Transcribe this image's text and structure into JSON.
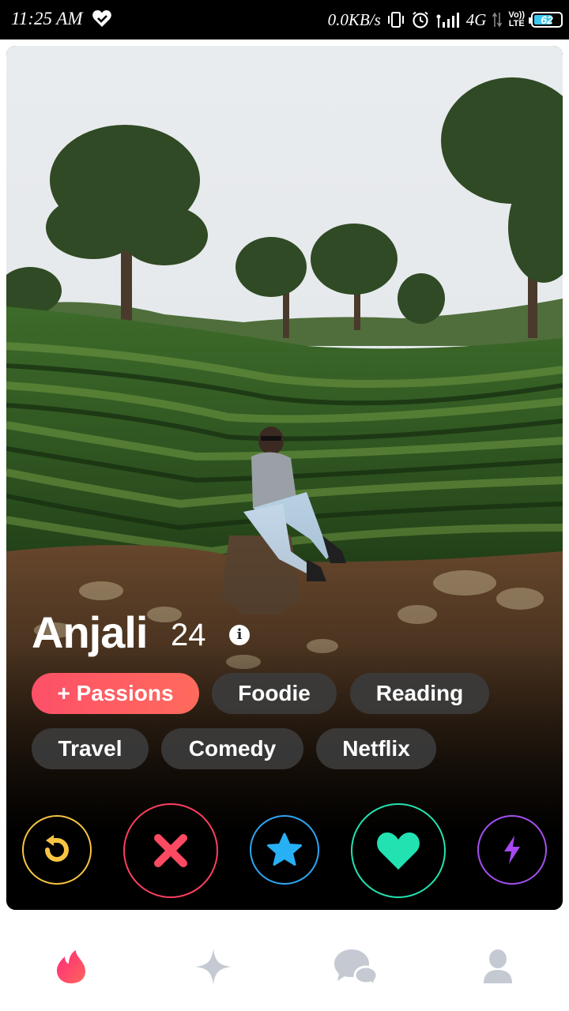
{
  "status_bar": {
    "time": "11:25 AM",
    "network_speed": "0.0KB/s",
    "network_type": "4G",
    "volte_label_top": "Vo))",
    "volte_label_bottom": "LTE",
    "battery_level": "62",
    "icons": [
      "heart-check-icon",
      "vibrate-icon",
      "alarm-icon",
      "signal-icon",
      "data-arrows-icon",
      "battery-icon"
    ]
  },
  "profile": {
    "name": "Anjali",
    "age": "24",
    "info_icon": "i",
    "tags": [
      {
        "label": "+ Passions",
        "highlight": true
      },
      {
        "label": "Foodie"
      },
      {
        "label": "Reading"
      },
      {
        "label": "Travel"
      },
      {
        "label": "Comedy"
      },
      {
        "label": "Netflix"
      }
    ]
  },
  "actions": [
    {
      "name": "rewind",
      "icon": "rewind-icon",
      "color": "#f7c543"
    },
    {
      "name": "nope",
      "icon": "close-icon",
      "color": "#fd3f5e"
    },
    {
      "name": "super-like",
      "icon": "star-icon",
      "color": "#2ea6f3"
    },
    {
      "name": "like",
      "icon": "heart-icon",
      "color": "#23e3b0"
    },
    {
      "name": "boost",
      "icon": "lightning-icon",
      "color": "#a54ff0"
    }
  ],
  "bottom_nav": [
    {
      "name": "discover",
      "icon": "flame-icon",
      "active": true,
      "color": "#fd4566"
    },
    {
      "name": "explore",
      "icon": "sparkle-icon",
      "active": false
    },
    {
      "name": "messages",
      "icon": "chat-icon",
      "active": false
    },
    {
      "name": "profile",
      "icon": "user-icon",
      "active": false
    }
  ],
  "colors": {
    "inactive_nav": "#c5cad2",
    "chip_bg": "#3c3c3c"
  }
}
